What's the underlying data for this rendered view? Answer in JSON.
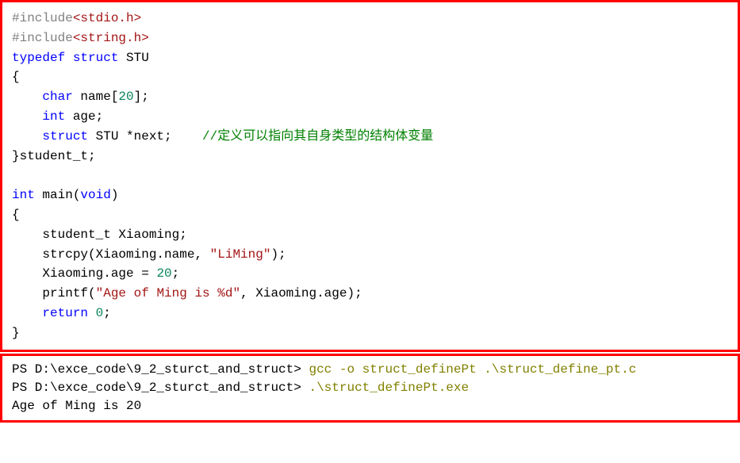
{
  "code": {
    "l1_include": "#include",
    "l1_hdr": "<stdio.h>",
    "l2_include": "#include",
    "l2_hdr": "<string.h>",
    "l3_typedef": "typedef",
    "l3_struct": "struct",
    "l3_name": " STU",
    "l4": "{",
    "l5_indent": "    ",
    "l5_char": "char",
    "l5_rest": " name[",
    "l5_num": "20",
    "l5_end": "];",
    "l6_indent": "    ",
    "l6_int": "int",
    "l6_rest": " age;",
    "l7_indent": "    ",
    "l7_struct": "struct",
    "l7_rest": " STU *next;    ",
    "l7_comment": "//定义可以指向其自身类型的结构体变量",
    "l8": "}student_t;",
    "l9": "",
    "l10_int": "int",
    "l10_main": " main(",
    "l10_void": "void",
    "l10_end": ")",
    "l11": "{",
    "l12_indent": "    ",
    "l12_rest": "student_t Xiaoming;",
    "l13_indent": "    ",
    "l13_a": "strcpy(Xiaoming.name, ",
    "l13_str": "\"LiMing\"",
    "l13_b": ");",
    "l14_indent": "    ",
    "l14_a": "Xiaoming.age = ",
    "l14_num": "20",
    "l14_b": ";",
    "l15_indent": "    ",
    "l15_a": "printf(",
    "l15_str": "\"Age of Ming is %d\"",
    "l15_b": ", Xiaoming.age);",
    "l16_indent": "    ",
    "l16_return": "return",
    "l16_sp": " ",
    "l16_num": "0",
    "l16_b": ";",
    "l17": "}"
  },
  "term": {
    "l1_prompt": "PS D:\\exce_code\\9_2_sturct_and_struct> ",
    "l1_cmd": "gcc -o struct_definePt .\\struct_define_pt.c",
    "l2_prompt": "PS D:\\exce_code\\9_2_sturct_and_struct> ",
    "l2_cmd": ".\\struct_definePt.exe",
    "l3": "Age of Ming is 20"
  }
}
